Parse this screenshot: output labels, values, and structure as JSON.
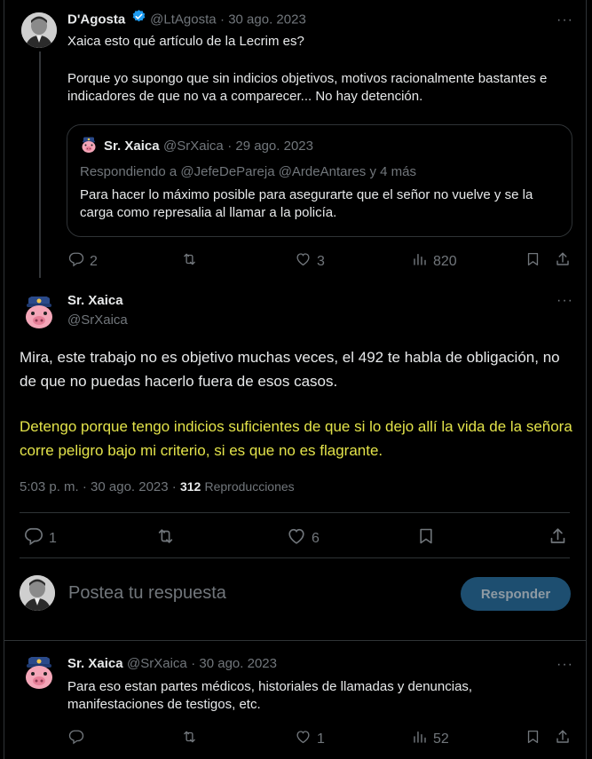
{
  "tweet1": {
    "name": "D'Agosta",
    "handle": "@LtAgosta",
    "date": "· 30 ago. 2023",
    "text_line1": "Xaica esto qué artículo de la Lecrim es?",
    "text_para2": "Porque yo supongo que sin indicios objetivos, motivos racionalmente bastantes e indicadores de que no va a comparecer... No hay detención.",
    "quote": {
      "name": "Sr. Xaica",
      "handle": "@SrXaica",
      "date": "· 29 ago. 2023",
      "replying": "Respondiendo a @JefeDePareja @ArdeAntares y 4 más",
      "text": "Para hacer lo máximo posible para asegurarte que el señor no vuelve y se la carga como represalia al llamar a la policía."
    },
    "replies": "2",
    "retweets": "",
    "likes": "3",
    "views": "820"
  },
  "main_tweet": {
    "name": "Sr. Xaica",
    "handle": "@SrXaica",
    "text_white": "Mira, este trabajo no es objetivo muchas veces, el 492 te habla de obligación, no de que no puedas hacerlo fuera de esos casos.",
    "text_yellow": "Detengo porque tengo indicios suficientes de que si lo dejo allí la vida de la señora corre peligro bajo mi criterio, si es que no es flagrante.",
    "timestamp": "5:03 p. m. · 30 ago. 2023 ·",
    "views_count": "312",
    "views_label": "Reproducciones",
    "replies": "1",
    "likes": "6"
  },
  "compose": {
    "placeholder": "Postea tu respuesta",
    "button": "Responder"
  },
  "tweet3": {
    "name": "Sr. Xaica",
    "handle": "@SrXaica",
    "date": "· 30 ago. 2023",
    "text": "Para eso estan partes médicos, historiales de llamadas y denuncias, manifestaciones de testigos, etc.",
    "likes": "1",
    "views": "52"
  },
  "colors": {
    "background": "#000000",
    "text": "#e7e9ea",
    "muted": "#71767b",
    "highlight": "#e3e34a",
    "verified": "#1d9bf0",
    "button": "#1d4e70"
  }
}
